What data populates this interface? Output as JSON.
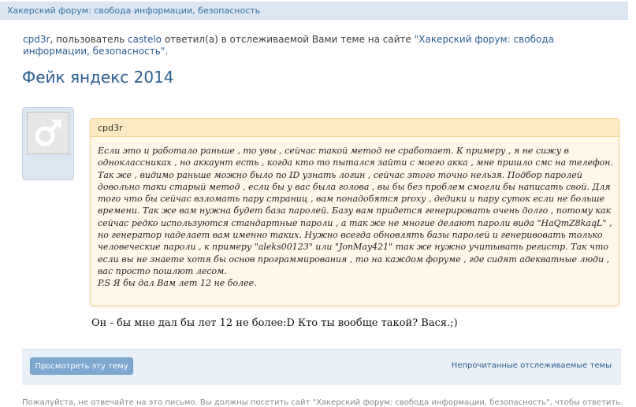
{
  "header": {
    "title": "Хакерский форум: свобода информации, безопасность"
  },
  "notice": {
    "actor": "cpd3r",
    "text1": ", пользователь ",
    "user": "castelo",
    "text2": " ответил(а) в отслеживаемой Вами теме на сайте ",
    "site_link": "\"Хакерский форум: свобода информации, безопасность\"",
    "text3": "."
  },
  "thread": {
    "title": "Фейк яндекс 2014"
  },
  "quote": {
    "author": "cpd3r",
    "body": "Если это и работало раньше , то увы , сейчас такой метод не сработает. К примеру , я не сижу в одноклассниках , но аккаунт есть , когда кто то пытался зайти с моего акка , мне пришло смс на телефон. Так же , видимо раньше можно было по ID узнать логин , сейчас этого точно нельзя. Подбор паролей довольно таки старый метод , если бы у вас была голова , вы бы без проблем смогли бы написать свой. Для того что бы сейчас взломать пару страниц , вам понадобятся proxy , дедики и пару суток если не больше времени. Так же вам нужна будет база паролей. Базу вам придется генерировать очень долго , потому как сейчас редко используются стандартные пароли , а так же не многие делают пароли вида \"HaQmZ8kaqL\" , но генератор наделает вам именно таких. Нужно всегда обновлять базы паролей и генеривовать только человеческие пароли , к примеру \"aleks00123\" или \"JonMay421\" так же нужно учитывать регистр. Так что если вы не знаете хотя бы основ программирования , то на каждом форуме , где сидят адекватные люди , вас просто пошлют лесом.",
    "ps": "P.S Я бы дал Вам лет 12 не более."
  },
  "reply": {
    "text": "Он - бы мне дал бы лет 12 не более:D Кто ты вообще такой? Вася.;)"
  },
  "actions": {
    "view_thread": "Просмотреть эту тему",
    "unread_watched": "Непрочитанные отслеживаемые темы"
  },
  "footer": {
    "disclaimer": "Пожалуйста, не отвечайте на это письмо. Вы должны посетить сайт \"Хакерский форум: свобода информации, безопасность\", чтобы ответить."
  },
  "colors": {
    "link": "#2b5e91",
    "header_bg": "#dbe6f2",
    "quote_bg": "#fff7e8",
    "quote_border": "#f3d49c",
    "button_bg": "#7ea8cf"
  },
  "icons": {
    "avatar": "male-symbol-icon"
  }
}
